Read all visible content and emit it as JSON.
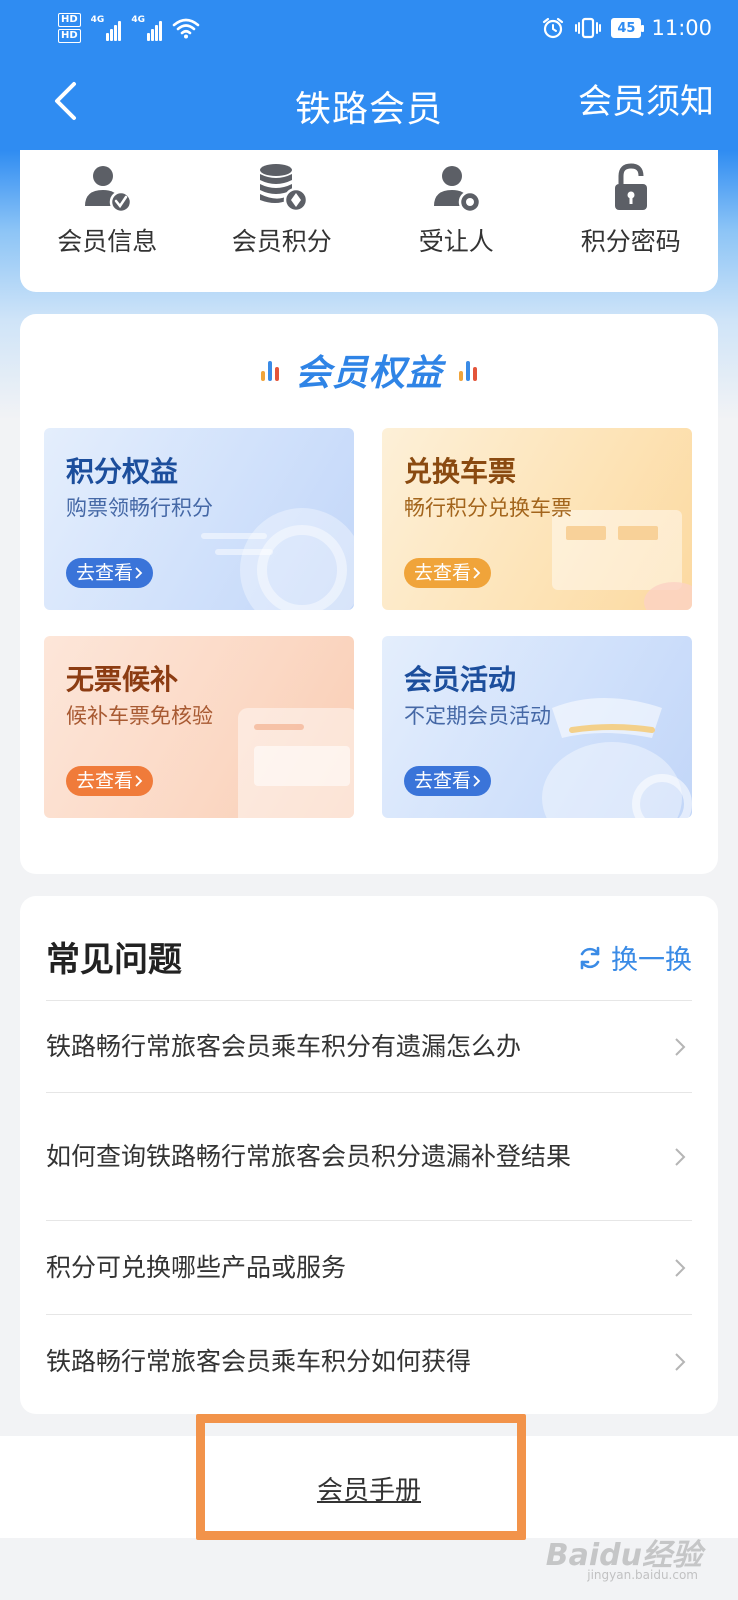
{
  "status_bar": {
    "hd1": "HD",
    "hd2": "HD",
    "net1": "4G",
    "net2": "4G",
    "battery": "45",
    "time": "11:00"
  },
  "nav": {
    "title": "铁路会员",
    "right_action": "会员须知"
  },
  "quick_entries": [
    {
      "label": "会员信息",
      "icon": "member-info-icon"
    },
    {
      "label": "会员积分",
      "icon": "points-coins-icon"
    },
    {
      "label": "受让人",
      "icon": "assignee-icon"
    },
    {
      "label": "积分密码",
      "icon": "lock-icon"
    }
  ],
  "benefits": {
    "title": "会员权益",
    "tiles": [
      {
        "title": "积分权益",
        "subtitle": "购票领畅行积分",
        "button": "去查看"
      },
      {
        "title": "兑换车票",
        "subtitle": "畅行积分兑换车票",
        "button": "去查看"
      },
      {
        "title": "无票候补",
        "subtitle": "候补车票免核验",
        "button": "去查看"
      },
      {
        "title": "会员活动",
        "subtitle": "不定期会员活动",
        "button": "去查看"
      }
    ]
  },
  "faq": {
    "title": "常见问题",
    "refresh_label": "换一换",
    "items": [
      "铁路畅行常旅客会员乘车积分有遗漏怎么办",
      "如何查询铁路畅行常旅客会员积分遗漏补登结果",
      "积分可兑换哪些产品或服务",
      "铁路畅行常旅客会员乘车积分如何获得"
    ]
  },
  "bottom": {
    "handbook_link": "会员手册"
  },
  "watermark": {
    "text": "Baidu经验",
    "sub": "jingyan.baidu.com"
  },
  "colors": {
    "primary_blue": "#2f8cf2",
    "link_blue": "#3a8be6",
    "highlight_orange": "#f2934a"
  }
}
